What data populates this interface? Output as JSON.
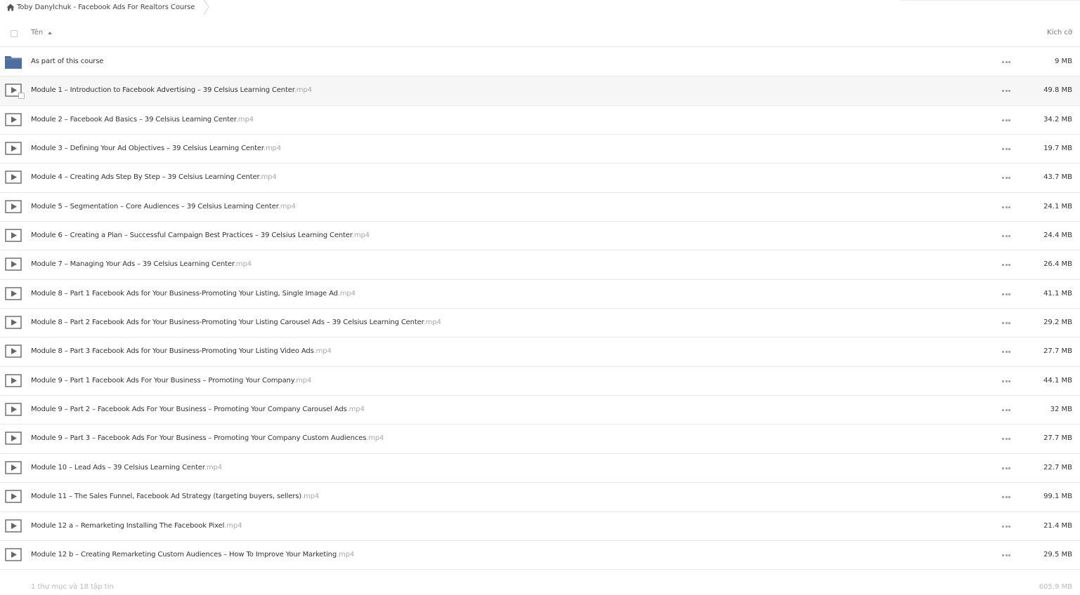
{
  "breadcrumb": {
    "title": "Toby Danylchuk - Facebook Ads For Realtors Course"
  },
  "header": {
    "name_label": "Tên",
    "size_label": "Kích cỡ"
  },
  "colors": {
    "folder": "#4d6fa0",
    "video_icon": "#666666",
    "extension": "#a8a8a8"
  },
  "rows": [
    {
      "icon": "folder-icon",
      "name": "As part of this course",
      "ext": "",
      "size": "9 MB"
    },
    {
      "icon": "video-icon",
      "name": "Module 1 – Introduction to Facebook Advertising – 39 Celsius Learning Center",
      "ext": ".mp4",
      "size": "49.8 MB"
    },
    {
      "icon": "video-icon",
      "name": "Module 2 – Facebook Ad Basics – 39 Celsius Learning Center",
      "ext": ".mp4",
      "size": "34.2 MB"
    },
    {
      "icon": "video-icon",
      "name": "Module 3 – Defining Your Ad Objectives – 39 Celsius Learning Center",
      "ext": ".mp4",
      "size": "19.7 MB"
    },
    {
      "icon": "video-icon",
      "name": "Module 4 – Creating Ads Step By Step – 39 Celsius Learning Center",
      "ext": ".mp4",
      "size": "43.7 MB"
    },
    {
      "icon": "video-icon",
      "name": "Module 5 – Segmentation – Core Audiences – 39 Celsius Learning Center",
      "ext": ".mp4",
      "size": "24.1 MB"
    },
    {
      "icon": "video-icon",
      "name": "Module 6 – Creating a Plan – Successful Campaign Best Practices – 39 Celsius Learning Center",
      "ext": ".mp4",
      "size": "24.4 MB"
    },
    {
      "icon": "video-icon",
      "name": "Module 7 – Managing Your Ads – 39 Celsius Learning Center",
      "ext": ".mp4",
      "size": "26.4 MB"
    },
    {
      "icon": "video-icon",
      "name": "Module 8 – Part 1 Facebook Ads for Your Business-Promoting Your Listing, Single Image Ad",
      "ext": ".mp4",
      "size": "41.1 MB"
    },
    {
      "icon": "video-icon",
      "name": "Module 8 – Part 2 Facebook Ads for Your Business-Promoting Your Listing Carousel Ads – 39 Celsius Learning Center",
      "ext": ".mp4",
      "size": "29.2 MB"
    },
    {
      "icon": "video-icon",
      "name": "Module 8 – Part 3 Facebook Ads for Your Business-Promoting Your Listing Video Ads",
      "ext": ".mp4",
      "size": "27.7 MB"
    },
    {
      "icon": "video-icon",
      "name": "Module 9 – Part 1 Facebook Ads For Your Business – Promoting Your Company",
      "ext": ".mp4",
      "size": "44.1 MB"
    },
    {
      "icon": "video-icon",
      "name": "Module 9 – Part 2 – Facebook Ads For Your Business – Promoting Your Company Carousel Ads",
      "ext": ".mp4",
      "size": "32 MB"
    },
    {
      "icon": "video-icon",
      "name": "Module 9 – Part 3 – Facebook Ads For Your Business – Promoting Your Company Custom Audiences",
      "ext": ".mp4",
      "size": "27.7 MB"
    },
    {
      "icon": "video-icon",
      "name": "Module 10 – Lead Ads – 39 Celsius Learning Center",
      "ext": ".mp4",
      "size": "22.7 MB"
    },
    {
      "icon": "video-icon",
      "name": "Module 11 – The Sales Funnel, Facebook Ad Strategy (targeting buyers, sellers)",
      "ext": ".mp4",
      "size": "99.1 MB"
    },
    {
      "icon": "video-icon",
      "name": "Module 12 a – Remarketing Installing The Facebook Pixel",
      "ext": ".mp4",
      "size": "21.4 MB"
    },
    {
      "icon": "video-icon",
      "name": "Module 12 b – Creating Remarketing Custom Audiences – How To Improve Your Marketing",
      "ext": ".mp4",
      "size": "29.5 MB"
    }
  ],
  "footer": {
    "summary": "1 thư mục và 18 tập tin",
    "total": "605.9 MB"
  }
}
